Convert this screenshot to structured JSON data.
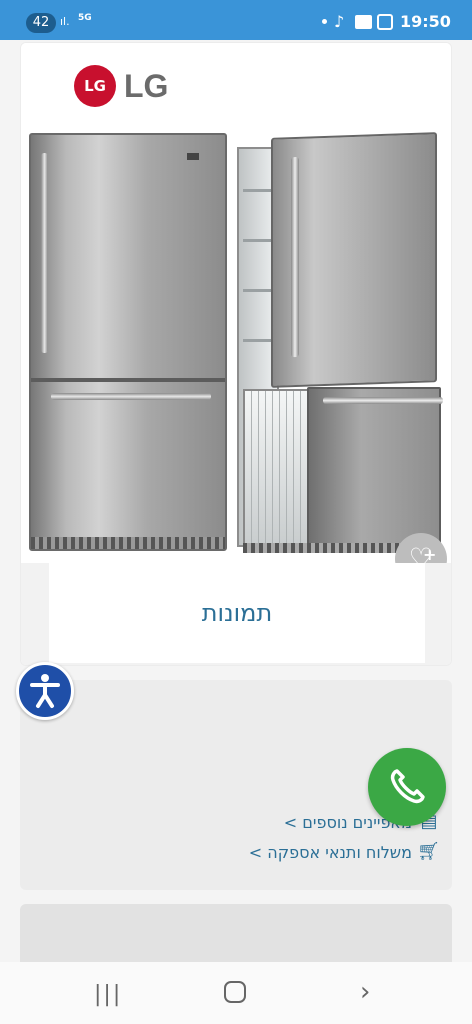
{
  "status_bar": {
    "notification_count": "42",
    "network_label": "5G",
    "time": "19:50",
    "icons": [
      "signal-icon",
      "tiktok-icon",
      "mail-icon",
      "screenshot-icon"
    ]
  },
  "product": {
    "brand_logo_text": "LG",
    "brand_logo_emblem": "LG",
    "gallery_label": "תמונות",
    "favorite_icon": "heart-plus-icon"
  },
  "links": [
    {
      "label": "מאפיינים נוספים >",
      "icon": "spec-list-icon"
    },
    {
      "label": "משלוח ותנאי אספקה >",
      "icon": "delivery-cart-icon"
    }
  ],
  "floating": {
    "accessibility_icon": "accessibility-icon",
    "call_icon": "phone-icon"
  },
  "colors": {
    "status_bar": "#3a94d8",
    "link": "#2b6f96",
    "call": "#3ba845",
    "accessibility": "#1f4fa8"
  }
}
